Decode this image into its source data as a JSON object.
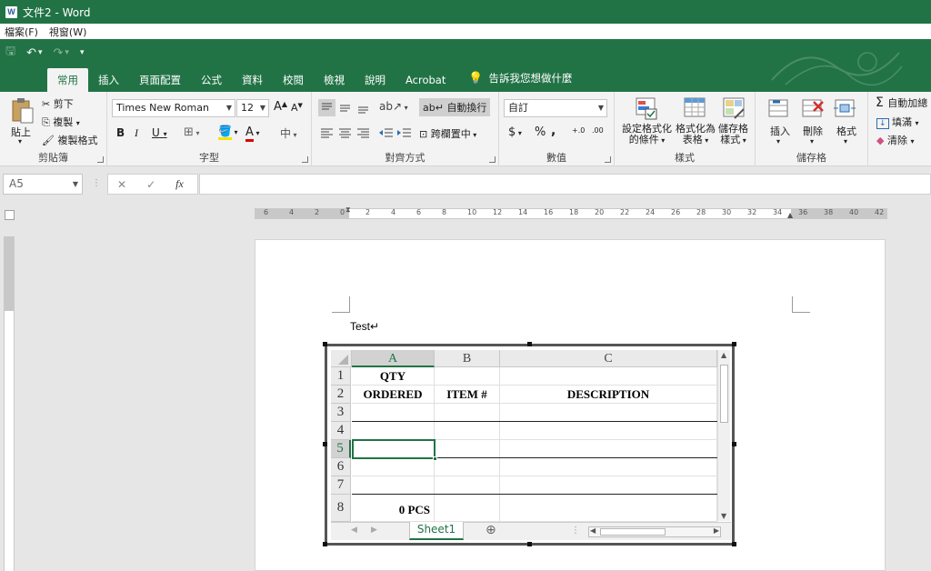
{
  "window": {
    "app_badge": "W",
    "title": "文件2 - Word"
  },
  "menu": [
    "檔案(F)",
    "視窗(W)"
  ],
  "qat": {
    "save": "🖫",
    "undo": "↶",
    "undo_dd": "▾",
    "redo": "↷",
    "redo_dd": "▾",
    "customize": "▾"
  },
  "tabs": [
    "常用",
    "插入",
    "頁面配置",
    "公式",
    "資料",
    "校閱",
    "檢視",
    "說明",
    "Acrobat"
  ],
  "active_tab": "常用",
  "tell_me": "告訴我您想做什麼",
  "ribbon": {
    "clipboard": {
      "label": "剪貼簿",
      "paste": "貼上",
      "cut": "剪下",
      "copy": "複製",
      "format_painter": "複製格式"
    },
    "font": {
      "label": "字型",
      "name": "Times New Roman",
      "size": "12",
      "grow": "A",
      "shrink": "A",
      "bold": "B",
      "italic": "I",
      "underline": "U",
      "font_color": "A",
      "phonetic": "中"
    },
    "alignment": {
      "label": "對齊方式",
      "wrap": "自動換行",
      "merge": "跨欄置中"
    },
    "number": {
      "label": "數值",
      "format": "自訂",
      "currency": "$",
      "percent": "%",
      "comma": ",",
      "inc_decimal": "+.0",
      "dec_decimal": ".00"
    },
    "styles": {
      "label": "樣式",
      "conditional": "設定格式化\n的條件",
      "table": "格式化為\n表格",
      "cell": "儲存格\n樣式"
    },
    "cells": {
      "label": "儲存格",
      "insert": "插入",
      "delete": "刪除",
      "format": "格式"
    },
    "editing": {
      "autosum": "自動加總",
      "fill": "填滿",
      "clear": "清除"
    }
  },
  "formula_bar": {
    "name_box": "A5",
    "cancel": "✕",
    "enter": "✓",
    "fx": "fx",
    "formula": ""
  },
  "document": {
    "text": "Test↵"
  },
  "spreadsheet": {
    "columns": [
      "A",
      "B",
      "C"
    ],
    "rows": [
      "1",
      "2",
      "3",
      "4",
      "5",
      "6",
      "7",
      "8"
    ],
    "cells": {
      "A1": "QTY",
      "A2": "ORDERED",
      "B2": "ITEM #",
      "C2": "DESCRIPTION",
      "A8": "0 PCS"
    },
    "selected_cell": "A5",
    "sheet_tab": "Sheet1",
    "add_sheet": "⊕"
  },
  "colors": {
    "excel_green": "#217346",
    "ribbon_bg": "#f3f3f3"
  }
}
